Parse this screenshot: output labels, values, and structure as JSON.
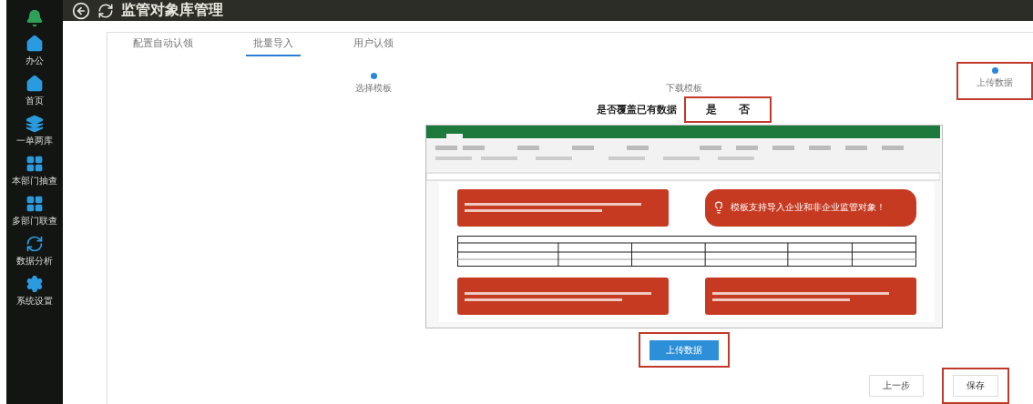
{
  "sidebar": {
    "items": [
      {
        "label": "办公",
        "kind": "home"
      },
      {
        "label": "首页",
        "kind": "home"
      },
      {
        "label": "一单两库",
        "kind": "layers"
      },
      {
        "label": "本部门抽查",
        "kind": "windows"
      },
      {
        "label": "多部门联查",
        "kind": "windows"
      },
      {
        "label": "数据分析",
        "kind": "refresh"
      },
      {
        "label": "系统设置",
        "kind": "gear"
      }
    ]
  },
  "header": {
    "title": "监管对象库管理"
  },
  "tabs": [
    {
      "label": "配置自动认领",
      "selected": false
    },
    {
      "label": "批量导入",
      "selected": true
    },
    {
      "label": "用户认领",
      "selected": false
    }
  ],
  "steps": [
    {
      "label": "选择模板",
      "dot": true,
      "highlighted": false
    },
    {
      "label": "下载模板",
      "dot": false,
      "highlighted": false
    },
    {
      "label": "上传数据",
      "dot": true,
      "highlighted": true
    }
  ],
  "overwrite": {
    "label": "是否覆盖已有数据",
    "options": [
      "是",
      "否"
    ],
    "highlighted": true
  },
  "template_preview": {
    "callouts": [
      {
        "kind": "note"
      },
      {
        "kind": "tip",
        "text": "模板支持导入企业和非企业监管对象！"
      },
      {
        "kind": "note"
      },
      {
        "kind": "note"
      }
    ]
  },
  "upload_button": {
    "label": "上传数据",
    "highlighted": true
  },
  "footer": {
    "buttons": [
      {
        "label": "上一步",
        "highlighted": false
      },
      {
        "label": "保存",
        "highlighted": true
      }
    ]
  }
}
